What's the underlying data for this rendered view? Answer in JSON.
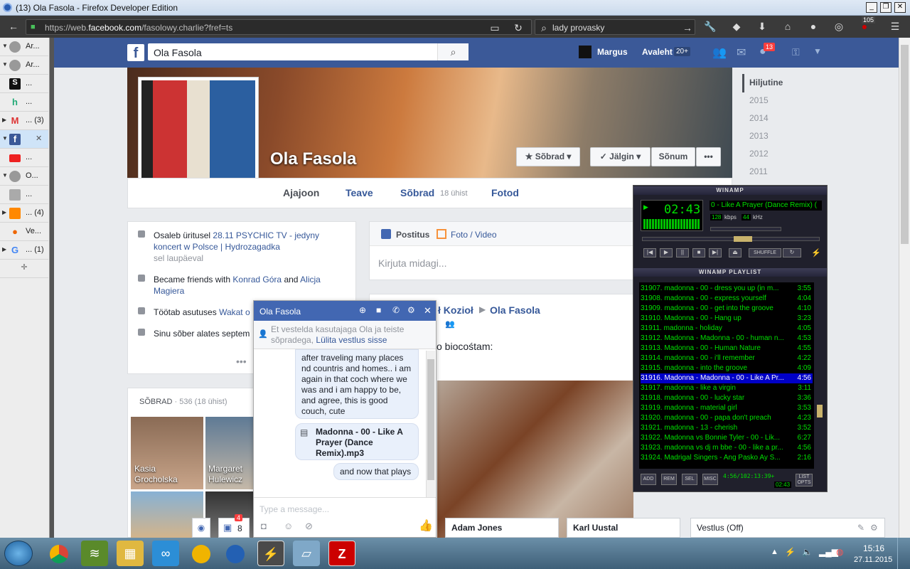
{
  "browser": {
    "window_title": "(13) Ola Fasola - Firefox Developer Edition",
    "url_prefix": "https://web.",
    "url_domain": "facebook.com",
    "url_rest": "/fasolowy.charlie?fref=ts",
    "search_value": "lady provasky",
    "badge_count": "105"
  },
  "tabs": [
    {
      "label": "Ar...",
      "arrow": "▼"
    },
    {
      "label": "Ar...",
      "arrow": "▼"
    },
    {
      "label": "...",
      "arrow": ""
    },
    {
      "label": "...",
      "arrow": ""
    },
    {
      "label": "... (3)",
      "arrow": "▶"
    },
    {
      "label": "...",
      "arrow": "▼"
    },
    {
      "label": "...",
      "arrow": ""
    },
    {
      "label": "O...",
      "arrow": "▼"
    },
    {
      "label": "...",
      "arrow": ""
    },
    {
      "label": "... (4)",
      "arrow": "▶"
    },
    {
      "label": "Ve...",
      "arrow": ""
    },
    {
      "label": "... (1)",
      "arrow": "▶"
    }
  ],
  "fb_header": {
    "search_value": "Ola Fasola",
    "user_name": "Margus",
    "home_label": "Avaleht",
    "home_badge": "20+",
    "notif_badge": "13"
  },
  "profile": {
    "name": "Ola Fasola",
    "friends_btn": "Sõbrad",
    "follow_btn": "Jälgin",
    "message_btn": "Sõnum",
    "more_btn": "•••",
    "tabs": {
      "timeline": "Ajajoon",
      "about": "Teave",
      "friends": "Sõbrad",
      "friends_sub": "18 ühist",
      "photos": "Fotod"
    }
  },
  "intro": {
    "event_pre": "Osaleb üritusel",
    "event_link": "28.11 PSYCHIC TV - jedyny koncert w Polsce | Hydrozagadka",
    "event_when": "sel laupäeval",
    "friends_pre": "Became friends with",
    "friend1": "Konrad Góra",
    "and": "and",
    "friend2": "Alicja Magiera",
    "work_pre": "Töötab asutuses",
    "work_link": "Wakat o",
    "since": "Sinu sõber alates septem",
    "more": "•••"
  },
  "friends_box": {
    "title": "SÕBRAD",
    "count": "· 536 (18 ühist)",
    "people": [
      "Kasia Grocholska",
      "Margaret Hulewicz"
    ]
  },
  "composer": {
    "status": "Postitus",
    "photo": "Foto / Video",
    "placeholder": "Kirjuta midagi..."
  },
  "post": {
    "author": "ł Kozioł",
    "target": "Ola Fasola",
    "text": "o biocośtam:"
  },
  "timeline_years": [
    "Hiljutine",
    "2015",
    "2014",
    "2013",
    "2012",
    "2011"
  ],
  "chat": {
    "name": "Ola Fasola",
    "notice_pre": "Et vestelda kasutajaga Ola ja teiste sõpradega,",
    "notice_link": "Lülita vestlus sisse",
    "msg1": "after traveling many places nd countris and homes.. i am again in that coch where we was and i am happy to be, and agree, this is good couch, cute",
    "file": "Madonna - 00 - Like A Prayer (Dance Remix).mp3",
    "msg2": "and now that plays",
    "input_placeholder": "Type a message..."
  },
  "winamp": {
    "title": "WINAMP",
    "time": "02:43",
    "song": "0 - Like A Prayer (Dance Remix) (",
    "kbps": "128",
    "khz": "44",
    "playlist_title": "WINAMP PLAYLIST",
    "playlist": [
      {
        "name": "31907. madonna - 00 - dress you up (in m...",
        "time": "3:55"
      },
      {
        "name": "31908. madonna - 00 - express yourself",
        "time": "4:04"
      },
      {
        "name": "31909. madonna - 00 - get into the groove",
        "time": "4:10"
      },
      {
        "name": "31910. Madonna - 00 - Hang up",
        "time": "3:23"
      },
      {
        "name": "31911. madonna - holiday",
        "time": "4:05"
      },
      {
        "name": "31912. Madonna - Madonna - 00 - human n...",
        "time": "4:53"
      },
      {
        "name": "31913. Madonna - 00 - Human Nature",
        "time": "4:55"
      },
      {
        "name": "31914. madonna - 00 - i'll remember",
        "time": "4:22"
      },
      {
        "name": "31915. madonna - into the groove",
        "time": "4:09"
      },
      {
        "name": "31916. Madonna - Madonna - 00 - Like A Pr...",
        "time": "4:56"
      },
      {
        "name": "31917. madonna - like a virgin",
        "time": "3:11"
      },
      {
        "name": "31918. madonna - 00 - lucky star",
        "time": "3:36"
      },
      {
        "name": "31919. madonna - material girl",
        "time": "3:53"
      },
      {
        "name": "31920. madonna - 00 - papa don't preach",
        "time": "4:23"
      },
      {
        "name": "31921. madonna - 13 - cherish",
        "time": "3:52"
      },
      {
        "name": "31922. Madonna vs Bonnie Tyler - 00 - Lik...",
        "time": "6:27"
      },
      {
        "name": "31923. madonna vs dj m bbe - 00 - like a pr...",
        "time": "4:56"
      },
      {
        "name": "31924. Madrigal Singers - Ang Pasko Ay S...",
        "time": "2:16"
      }
    ],
    "selected_index": 9,
    "btn_add": "ADD",
    "btn_rem": "REM",
    "btn_sel": "SEL",
    "btn_misc": "MISC",
    "btn_list": "LIST OPTS",
    "pl_time": "4:56/102:13:39+",
    "pl_time2": "02:43"
  },
  "dock": {
    "chat1": "Adam Jones",
    "chat2": "Karl Uustal",
    "status": "Vestlus (Off)",
    "msg_badge": "4",
    "msg_count": "8"
  },
  "taskbar": {
    "time": "15:16",
    "date": "27.11.2015"
  }
}
